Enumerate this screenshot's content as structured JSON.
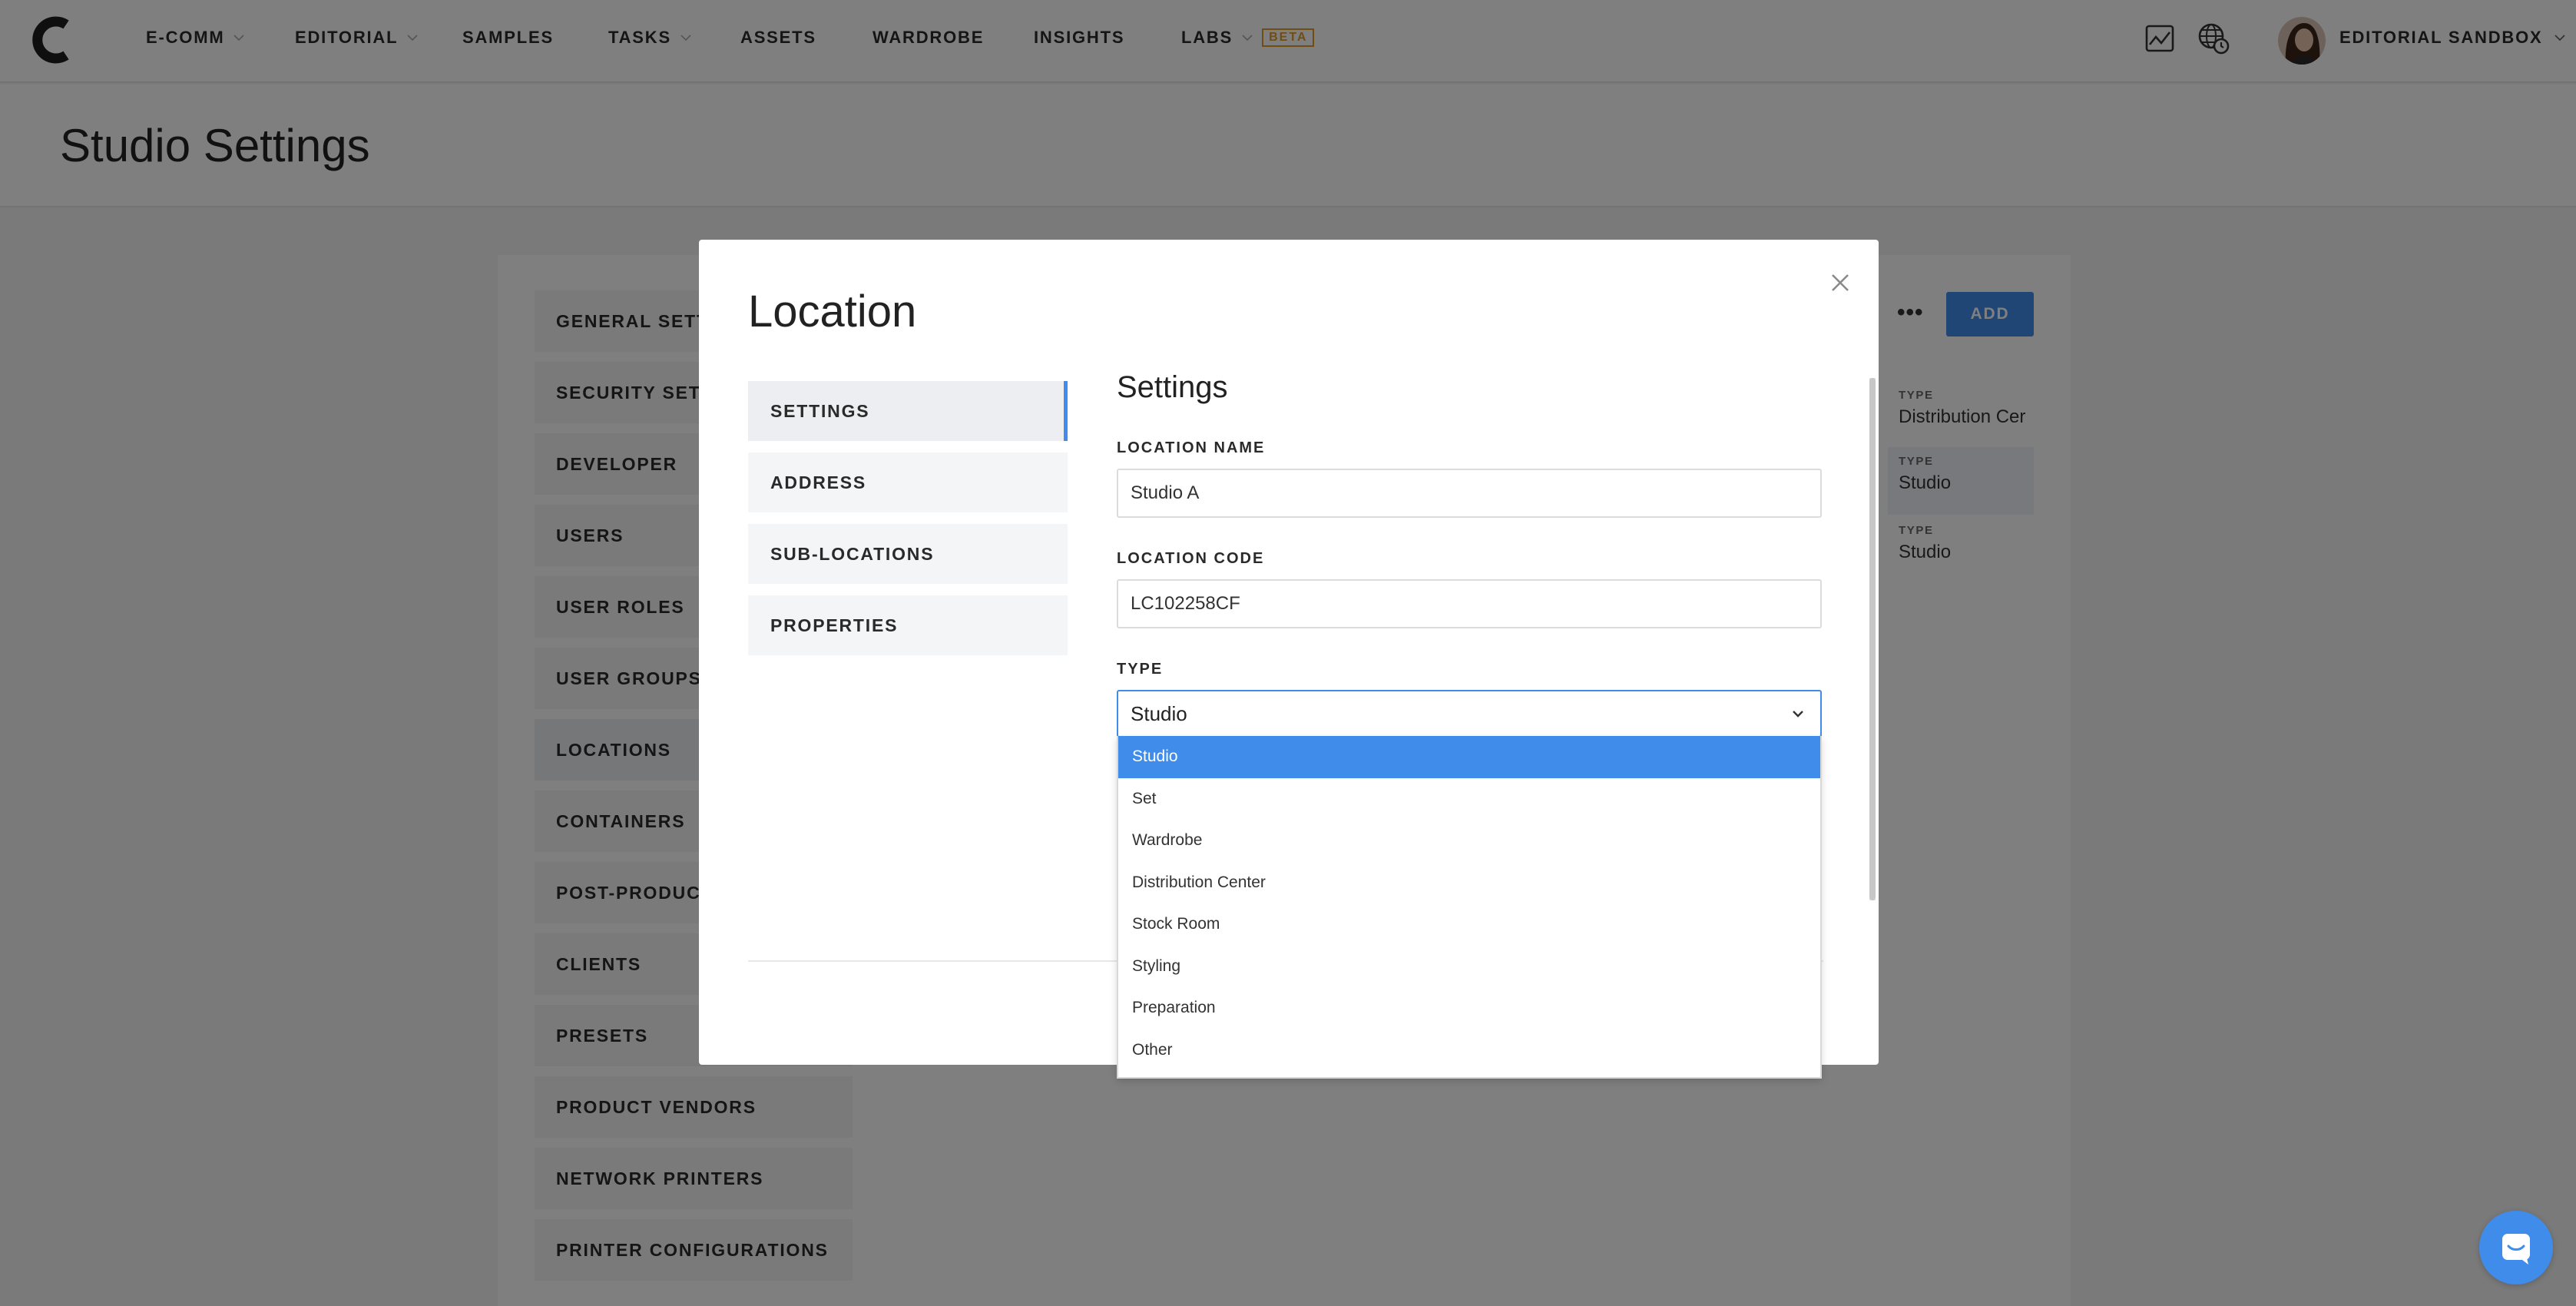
{
  "nav": {
    "items": [
      {
        "label": "E-COMM",
        "dropdown": true
      },
      {
        "label": "EDITORIAL",
        "dropdown": true
      },
      {
        "label": "SAMPLES",
        "dropdown": false
      },
      {
        "label": "TASKS",
        "dropdown": true
      },
      {
        "label": "ASSETS",
        "dropdown": false
      },
      {
        "label": "WARDROBE",
        "dropdown": false
      },
      {
        "label": "INSIGHTS",
        "dropdown": false
      },
      {
        "label": "LABS",
        "dropdown": true
      }
    ],
    "beta_badge": "BETA",
    "account_label": "EDITORIAL SANDBOX",
    "icons": [
      "logo-icon",
      "activity-chart-icon",
      "globe-clock-icon"
    ]
  },
  "page": {
    "title": "Studio Settings"
  },
  "sidebar": {
    "items": [
      "GENERAL SETTINGS",
      "SECURITY SETTINGS",
      "DEVELOPER",
      "USERS",
      "USER ROLES",
      "USER GROUPS",
      "LOCATIONS",
      "CONTAINERS",
      "POST-PRODUCTION",
      "CLIENTS",
      "PRESETS",
      "PRODUCT VENDORS",
      "NETWORK PRINTERS",
      "PRINTER CONFIGURATIONS"
    ],
    "active": "LOCATIONS"
  },
  "location_list": {
    "more_label": "•••",
    "add_label": "ADD",
    "cards": [
      {
        "key": "TYPE",
        "value": "Distribution Cer"
      },
      {
        "key": "TYPE",
        "value": "Studio"
      },
      {
        "key": "TYPE",
        "value": "Studio"
      }
    ]
  },
  "modal": {
    "title": "Location",
    "tabs": [
      "SETTINGS",
      "ADDRESS",
      "SUB-LOCATIONS",
      "PROPERTIES"
    ],
    "active_tab": "SETTINGS",
    "section_title": "Settings",
    "location_name": {
      "label": "LOCATION NAME",
      "value": "Studio A"
    },
    "location_code": {
      "label": "LOCATION CODE",
      "value": "LC102258CF"
    },
    "type": {
      "label": "TYPE",
      "value": "Studio",
      "options": [
        "Studio",
        "Set",
        "Wardrobe",
        "Distribution Center",
        "Stock Room",
        "Styling",
        "Preparation",
        "Other"
      ]
    }
  },
  "colors": {
    "accent": "#3f8ceb",
    "beta": "#e29a25",
    "overlay": "rgba(0,0,0,0.5)"
  }
}
